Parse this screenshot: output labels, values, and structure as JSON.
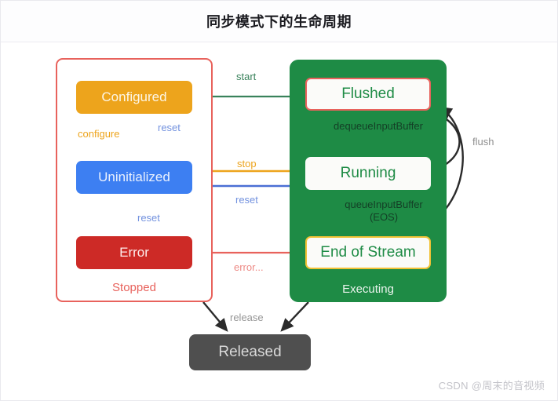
{
  "header": {
    "title": "同步模式下的生命周期"
  },
  "diagram": {
    "type": "state-machine",
    "groups": [
      {
        "id": "stopped",
        "label": "Stopped",
        "border_color": "#e8625c",
        "fill": "#ffffff"
      },
      {
        "id": "executing",
        "label": "Executing",
        "fill": "#1e8b45",
        "label_color": "#e9f3ec"
      }
    ],
    "nodes": [
      {
        "id": "configured",
        "label": "Configured",
        "fill": "#eda41c",
        "text_color": "#fdf6e6",
        "group": "stopped"
      },
      {
        "id": "uninitialized",
        "label": "Uninitialized",
        "fill": "#3d7ff2",
        "text_color": "#eaf1fe",
        "group": "stopped"
      },
      {
        "id": "error",
        "label": "Error",
        "fill": "#cd2a26",
        "text_color": "#fdeceb",
        "group": "stopped"
      },
      {
        "id": "flushed",
        "label": "Flushed",
        "fill": "#fbfbf9",
        "border_color": "#e8625c",
        "text_color": "#1e8b45",
        "group": "executing"
      },
      {
        "id": "running",
        "label": "Running",
        "fill": "#fbfbf9",
        "border_color": "#fbfbf9",
        "text_color": "#1e8b45",
        "group": "executing"
      },
      {
        "id": "eos",
        "label": "End of Stream",
        "fill": "#fbfbf9",
        "border_color": "#f2c235",
        "text_color": "#1e8b45",
        "group": "executing"
      },
      {
        "id": "released",
        "label": "Released",
        "fill": "#4f4f4f",
        "text_color": "#d9d9d9",
        "group": null
      }
    ],
    "edges": [
      {
        "id": "configure",
        "label": "configure",
        "from": "uninitialized",
        "to": "configured",
        "color": "#eda41c"
      },
      {
        "id": "reset-top",
        "label": "reset",
        "from": "configured",
        "to": "uninitialized",
        "color": "#7392df"
      },
      {
        "id": "reset-bottom",
        "label": "reset",
        "from": "error",
        "to": "uninitialized",
        "color": "#7392df"
      },
      {
        "id": "start",
        "label": "start",
        "from": "configured",
        "to": "flushed",
        "color": "#39825b"
      },
      {
        "id": "stop",
        "label": "stop",
        "from": "executing",
        "to": "uninitialized",
        "color": "#eda41c"
      },
      {
        "id": "reset-mid",
        "label": "reset",
        "from": "executing",
        "to": "uninitialized",
        "color": "#7392df"
      },
      {
        "id": "error-edge",
        "label": "error...",
        "from": "executing",
        "to": "error",
        "color": "#ed8a85"
      },
      {
        "id": "release",
        "label": "release",
        "from": "stopped,executing",
        "to": "released",
        "color": "#3a3a3a"
      },
      {
        "id": "dequeue",
        "label": "dequeueInputBuffer",
        "from": "flushed",
        "to": "running",
        "color": "#143f26"
      },
      {
        "id": "queue-eos",
        "label": "queueInputBuffer\n(EOS)",
        "from": "running",
        "to": "eos",
        "color": "#143f26"
      },
      {
        "id": "flush",
        "label": "flush",
        "from": "running,eos",
        "to": "flushed",
        "color": "#8f8f8f"
      }
    ]
  },
  "labels": {
    "configure": "configure",
    "reset_top": "reset",
    "reset_bottom": "reset",
    "start": "start",
    "stop": "stop",
    "reset_mid": "reset",
    "error": "error...",
    "release": "release",
    "flush": "flush",
    "dequeue": "dequeueInputBuffer",
    "queue_line1": "queueInputBuffer",
    "queue_line2": "(EOS)"
  },
  "watermark": {
    "text": "CSDN @周末的音视频"
  }
}
